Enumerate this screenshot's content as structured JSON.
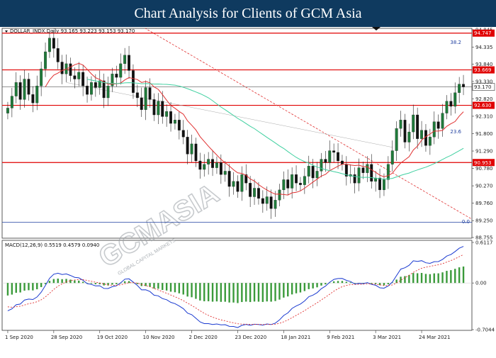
{
  "title": "Chart Analysis for Clients of GCM Asia",
  "header_info": "DOLLAR_INDX,Daily  93.165 93.223 93.153 93.170",
  "macd_info": "MACD(12,26,9) 0.5519 0.4579 0.0940",
  "watermark": {
    "main": "GCMASIA",
    "sub": "GLOBAL CAPITAL MARKETS"
  },
  "fib_labels": {
    "top": "38.2",
    "mid": "23.6",
    "bottom": "0.0"
  },
  "colors": {
    "title_bg": "#0f3a5f",
    "bull": "#1f7a3a",
    "bear": "#111111",
    "ma_fast": "#e03030",
    "ma_slow": "#40d0a0",
    "level": "#e00000",
    "fib": "#2040a0",
    "macd_hist": "#3a9a3a",
    "macd_line": "#1a3ad0",
    "signal_line": "#e03030"
  },
  "chart_data": {
    "type": "candlestick",
    "instrument": "DOLLAR_INDX",
    "timeframe": "Daily",
    "ohlc_current": {
      "open": 93.165,
      "high": 93.223,
      "low": 93.153,
      "close": 93.17
    },
    "price_axis": {
      "min": 88.755,
      "max": 94.845,
      "ticks": [
        "94.845",
        "94.335",
        "93.840",
        "93.330",
        "92.820",
        "92.310",
        "91.800",
        "91.290",
        "90.780",
        "90.270",
        "89.760",
        "89.250",
        "88.755"
      ]
    },
    "price_tags": [
      {
        "label": "94.747",
        "value": 94.747
      },
      {
        "label": "93.669",
        "value": 93.669
      },
      {
        "label": "93.170",
        "value": 93.17
      },
      {
        "label": "92.630",
        "value": 92.63
      },
      {
        "label": "90.953",
        "value": 90.953
      }
    ],
    "horizontal_levels": [
      94.747,
      93.669,
      92.63,
      90.953
    ],
    "fib_levels": [
      {
        "label": "38.2",
        "value": 94.747
      },
      {
        "label": "23.6",
        "value": 92.63
      },
      {
        "label": "0.0",
        "value": 89.2
      }
    ],
    "x_ticks": [
      "1 Sep 2020",
      "28 Sep 2020",
      "19 Oct 2020",
      "10 Nov 2020",
      "2 Dec 2020",
      "23 Dec 2020",
      "18 Jan 2021",
      "9 Feb 2021",
      "3 Mar 2021",
      "24 Mar 2021"
    ],
    "closes": [
      92.55,
      92.9,
      93.3,
      92.8,
      93.4,
      92.95,
      92.7,
      93.2,
      93.7,
      94.2,
      94.6,
      94.3,
      93.9,
      93.55,
      93.85,
      93.5,
      93.4,
      93.6,
      93.2,
      92.95,
      93.3,
      93.15,
      93.35,
      92.85,
      93.2,
      93.55,
      93.45,
      93.85,
      94.1,
      93.65,
      93.0,
      92.85,
      92.5,
      93.15,
      92.8,
      92.35,
      92.75,
      92.3,
      92.45,
      92.1,
      92.2,
      91.9,
      91.7,
      91.2,
      91.5,
      91.0,
      90.75,
      90.9,
      91.05,
      90.8,
      90.95,
      90.6,
      90.7,
      90.25,
      90.4,
      90.1,
      90.6,
      90.35,
      89.95,
      90.2,
      89.9,
      89.75,
      89.95,
      89.6,
      89.85,
      90.15,
      90.45,
      90.2,
      90.6,
      90.35,
      90.3,
      90.55,
      90.85,
      90.5,
      90.7,
      91.05,
      90.95,
      91.3,
      91.25,
      91.0,
      90.9,
      90.55,
      90.6,
      90.35,
      90.8,
      90.65,
      90.9,
      90.4,
      90.5,
      90.15,
      90.45,
      90.9,
      91.3,
      91.95,
      92.2,
      91.55,
      91.85,
      92.35,
      91.65,
      91.9,
      91.45,
      91.7,
      92.15,
      91.95,
      92.4,
      92.75,
      92.6,
      93.0,
      93.25,
      93.17
    ],
    "macd": {
      "range": {
        "min": -0.7044,
        "max": 0.6117
      },
      "ticks": [
        "0.6117",
        "0.00",
        "-0.7044"
      ],
      "main": 0.5519,
      "signal": 0.4579,
      "histogram": 0.094
    }
  }
}
